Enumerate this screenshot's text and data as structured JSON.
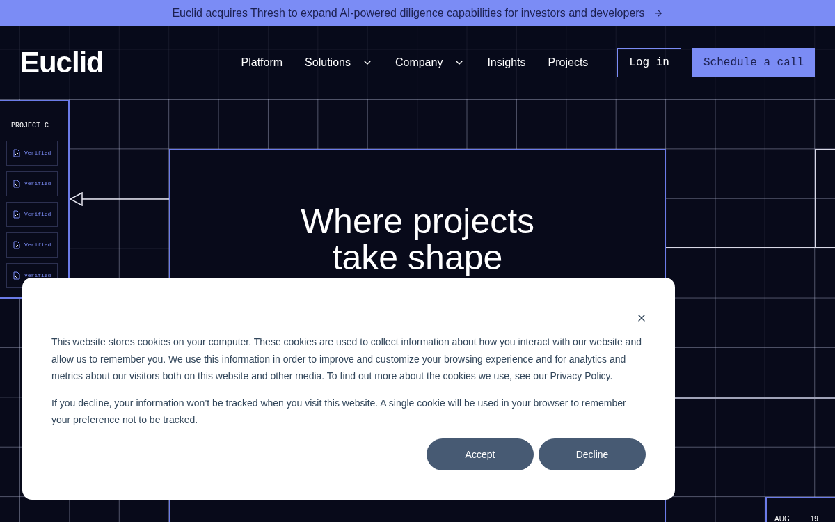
{
  "announcement": {
    "text": "Euclid acquires Thresh to expand AI-powered diligence capabilities for investors and developers"
  },
  "nav": {
    "logo": "Euclid",
    "links": [
      {
        "label": "Platform",
        "dropdown": false
      },
      {
        "label": "Solutions",
        "dropdown": true
      },
      {
        "label": "Company",
        "dropdown": true
      },
      {
        "label": "Insights",
        "dropdown": false
      },
      {
        "label": "Projects",
        "dropdown": false
      }
    ],
    "login": "Log in",
    "cta": "Schedule a call"
  },
  "hero": {
    "heading_lines": [
      "Where projects",
      "take shape"
    ]
  },
  "project_card": {
    "title": "PROJECT C",
    "items": [
      {
        "label": "Verified"
      },
      {
        "label": "Verified"
      },
      {
        "label": "Verified"
      },
      {
        "label": "Verified"
      },
      {
        "label": "Verified"
      }
    ]
  },
  "date_card": {
    "month": "AUG",
    "day": "19"
  },
  "cookie_dialog": {
    "paragraphs": [
      "This website stores cookies on your computer. These cookies are used to collect information about how you interact with our website and allow us to remember you. We use this information in order to improve and customize your browsing experience and for analytics and metrics about our visitors both on this website and other media. To find out more about the cookies we use, see our Privacy Policy.",
      "If you decline, your information won’t be tracked when you visit this website. A single cookie will be used in your browser to remember your preference not to be tracked."
    ],
    "buttons": [
      "Accept",
      "Decline"
    ]
  }
}
